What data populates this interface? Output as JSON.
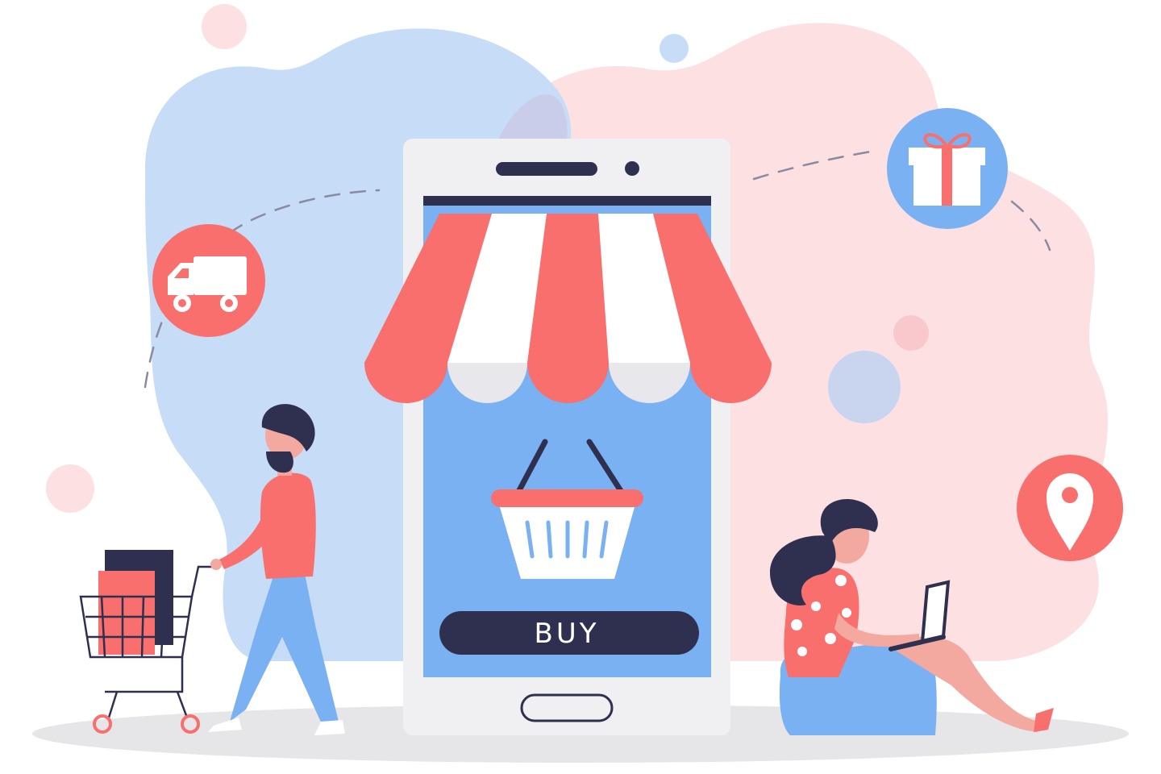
{
  "phone": {
    "buy_label": "BUY"
  },
  "colors": {
    "coral": "#f86f6d",
    "navy": "#2f2f4f",
    "blue": "#7ab1f3",
    "light_blue": "#c6dcf7",
    "pink": "#fde0e2",
    "awning_white": "#ffffff",
    "phone_body": "#f0f0f2",
    "ground": "#e6e6e8"
  },
  "icons": [
    "delivery-truck-icon",
    "gift-icon",
    "location-pin-icon",
    "shopping-basket-icon",
    "shopping-cart-icon"
  ]
}
